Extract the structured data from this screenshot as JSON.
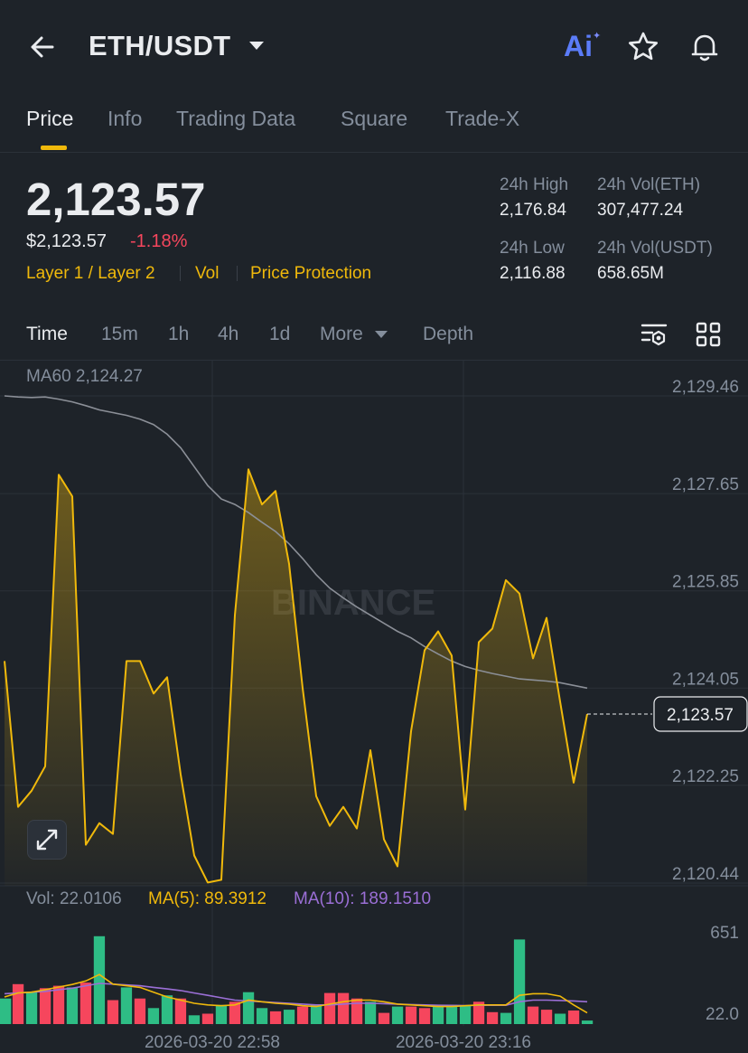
{
  "header": {
    "pair": "ETH/USDT",
    "ai_label": "Ai"
  },
  "tabs": [
    {
      "label": "Price",
      "active": true
    },
    {
      "label": "Info",
      "active": false
    },
    {
      "label": "Trading Data",
      "active": false
    },
    {
      "label": "Square",
      "active": false
    },
    {
      "label": "Trade-X",
      "active": false
    }
  ],
  "summary": {
    "last_price": "2,123.57",
    "usd_price": "$2,123.57",
    "change_pct": "-1.18%",
    "tags": [
      "Layer 1 / Layer 2",
      "Vol",
      "Price Protection"
    ],
    "high_label": "24h High",
    "high_value": "2,176.84",
    "low_label": "24h Low",
    "low_value": "2,116.88",
    "vol_base_label": "24h Vol(ETH)",
    "vol_base_value": "307,477.24",
    "vol_quote_label": "24h Vol(USDT)",
    "vol_quote_value": "658.65M"
  },
  "intervals": {
    "items": [
      "Time",
      "15m",
      "1h",
      "4h",
      "1d",
      "More",
      "Depth"
    ],
    "active": "Time"
  },
  "colors": {
    "background": "#1e2329",
    "accent": "#f0b90b",
    "down": "#f6465d",
    "up": "#2ebd85",
    "ma60": "#8b8f97",
    "ma10": "#9b6fd6"
  },
  "chart_data": {
    "type": "line",
    "ma60_label": "MA60 2,124.27",
    "watermark": "BINANCE",
    "y_ticks": [
      "2,129.46",
      "2,127.65",
      "2,125.85",
      "2,124.05",
      "2,122.25",
      "2,120.44"
    ],
    "y_tick_values": [
      2129.46,
      2127.65,
      2125.85,
      2124.05,
      2122.25,
      2120.44
    ],
    "current_price_label": "2,123.57",
    "current_price": 2123.57,
    "x_ticks": [
      "2026-03-20 22:58",
      "2026-03-20 23:16"
    ],
    "price": [
      2124.55,
      2121.85,
      2122.15,
      2122.6,
      2128.0,
      2127.6,
      2121.15,
      2121.55,
      2121.35,
      2124.55,
      2124.55,
      2123.95,
      2124.25,
      2122.45,
      2120.95,
      2120.45,
      2120.5,
      2125.4,
      2128.1,
      2127.45,
      2127.7,
      2126.35,
      2124.05,
      2122.05,
      2121.5,
      2121.85,
      2121.45,
      2122.9,
      2121.25,
      2120.75,
      2123.25,
      2124.75,
      2125.1,
      2124.65,
      2121.8,
      2124.9,
      2125.15,
      2126.05,
      2125.8,
      2124.6,
      2125.35,
      2123.8,
      2122.3,
      2123.57
    ],
    "ma60": [
      2129.46,
      2129.44,
      2129.43,
      2129.44,
      2129.4,
      2129.35,
      2129.28,
      2129.2,
      2129.15,
      2129.1,
      2129.03,
      2128.93,
      2128.75,
      2128.5,
      2128.15,
      2127.8,
      2127.55,
      2127.45,
      2127.3,
      2127.12,
      2126.95,
      2126.72,
      2126.45,
      2126.15,
      2125.9,
      2125.72,
      2125.55,
      2125.4,
      2125.25,
      2125.1,
      2124.98,
      2124.82,
      2124.68,
      2124.55,
      2124.45,
      2124.38,
      2124.32,
      2124.27,
      2124.22,
      2124.2,
      2124.18,
      2124.15,
      2124.1,
      2124.05
    ],
    "volume_legend": {
      "vol": "Vol: 22.0106",
      "ma5": "MA(5): 89.3912",
      "ma10": "MA(10): 189.1510"
    },
    "volume_ticks": [
      "651",
      "22.0"
    ],
    "volume_tick_values": [
      651,
      22.0
    ],
    "volume": [
      160,
      250,
      200,
      225,
      240,
      230,
      260,
      550,
      150,
      230,
      160,
      100,
      180,
      160,
      55,
      65,
      120,
      140,
      200,
      100,
      80,
      90,
      110,
      120,
      195,
      195,
      160,
      140,
      70,
      110,
      110,
      100,
      120,
      120,
      115,
      140,
      75,
      70,
      530,
      110,
      90,
      65,
      85,
      22
    ],
    "volume_up": [
      true,
      false,
      true,
      false,
      false,
      true,
      false,
      true,
      false,
      true,
      false,
      true,
      true,
      false,
      true,
      false,
      true,
      false,
      true,
      true,
      false,
      true,
      false,
      true,
      false,
      false,
      false,
      true,
      false,
      true,
      false,
      false,
      true,
      true,
      true,
      false,
      false,
      true,
      true,
      false,
      false,
      true,
      false,
      true
    ],
    "vol_ma5": [
      170,
      195,
      200,
      215,
      232,
      248,
      270,
      310,
      250,
      240,
      230,
      200,
      170,
      150,
      130,
      120,
      115,
      120,
      150,
      140,
      130,
      125,
      115,
      110,
      125,
      140,
      150,
      150,
      140,
      125,
      120,
      115,
      110,
      110,
      115,
      120,
      120,
      120,
      180,
      190,
      190,
      175,
      120,
      70
    ],
    "vol_ma10": [
      190,
      195,
      200,
      205,
      215,
      225,
      240,
      255,
      250,
      245,
      240,
      230,
      220,
      210,
      195,
      180,
      165,
      150,
      145,
      140,
      135,
      130,
      125,
      120,
      120,
      125,
      130,
      130,
      128,
      125,
      122,
      120,
      118,
      117,
      116,
      118,
      118,
      118,
      140,
      150,
      150,
      148,
      145,
      140
    ]
  }
}
